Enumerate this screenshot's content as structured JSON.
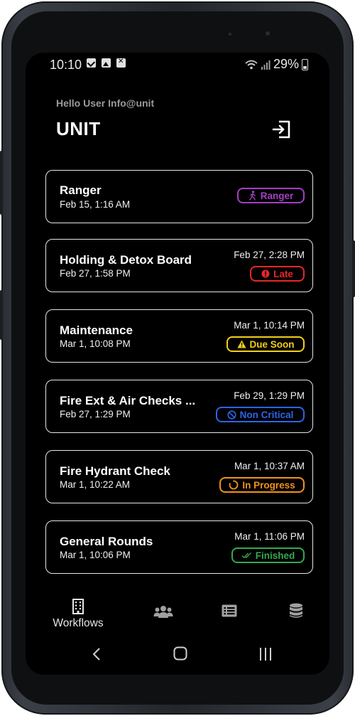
{
  "status_bar": {
    "time": "10:10",
    "battery": "29%"
  },
  "header": {
    "greeting": "Hello User Info@unit",
    "title": "UNIT"
  },
  "colors": {
    "purple": "#a43fc4",
    "red": "#e8262a",
    "yellow": "#f2cf1b",
    "blue": "#2f63e8",
    "orange": "#f2921a",
    "green": "#35a851"
  },
  "workflows": [
    {
      "title": "Ranger",
      "created": "Feb 15, 1:16 AM",
      "due": "",
      "badge": "Ranger",
      "badge_icon": "walking-person-icon",
      "color": "#a43fc4"
    },
    {
      "title": "Holding & Detox Board",
      "created": "Feb 27, 1:58 PM",
      "due": "Feb 27, 2:28 PM",
      "badge": "Late",
      "badge_icon": "alert-circle-icon",
      "color": "#e8262a"
    },
    {
      "title": "Maintenance",
      "created": "Mar 1, 10:08 PM",
      "due": "Mar 1, 10:14 PM",
      "badge": "Due Soon",
      "badge_icon": "warning-triangle-icon",
      "color": "#f2cf1b"
    },
    {
      "title": "Fire Ext & Air Checks ...",
      "created": "Feb 27, 1:29 PM",
      "due": "Feb 29, 1:29 PM",
      "badge": "Non Critical",
      "badge_icon": "no-entry-icon",
      "color": "#2f63e8"
    },
    {
      "title": "Fire Hydrant Check",
      "created": "Mar 1, 10:22 AM",
      "due": "Mar 1, 10:37 AM",
      "badge": "In Progress",
      "badge_icon": "progress-circle-icon",
      "color": "#f2921a"
    },
    {
      "title": "General Rounds",
      "created": "Mar 1, 10:06 PM",
      "due": "Mar 1, 11:06 PM",
      "badge": "Finished",
      "badge_icon": "double-check-icon",
      "color": "#35a851"
    }
  ],
  "bottom_nav": {
    "workflows_label": "Workflows"
  }
}
